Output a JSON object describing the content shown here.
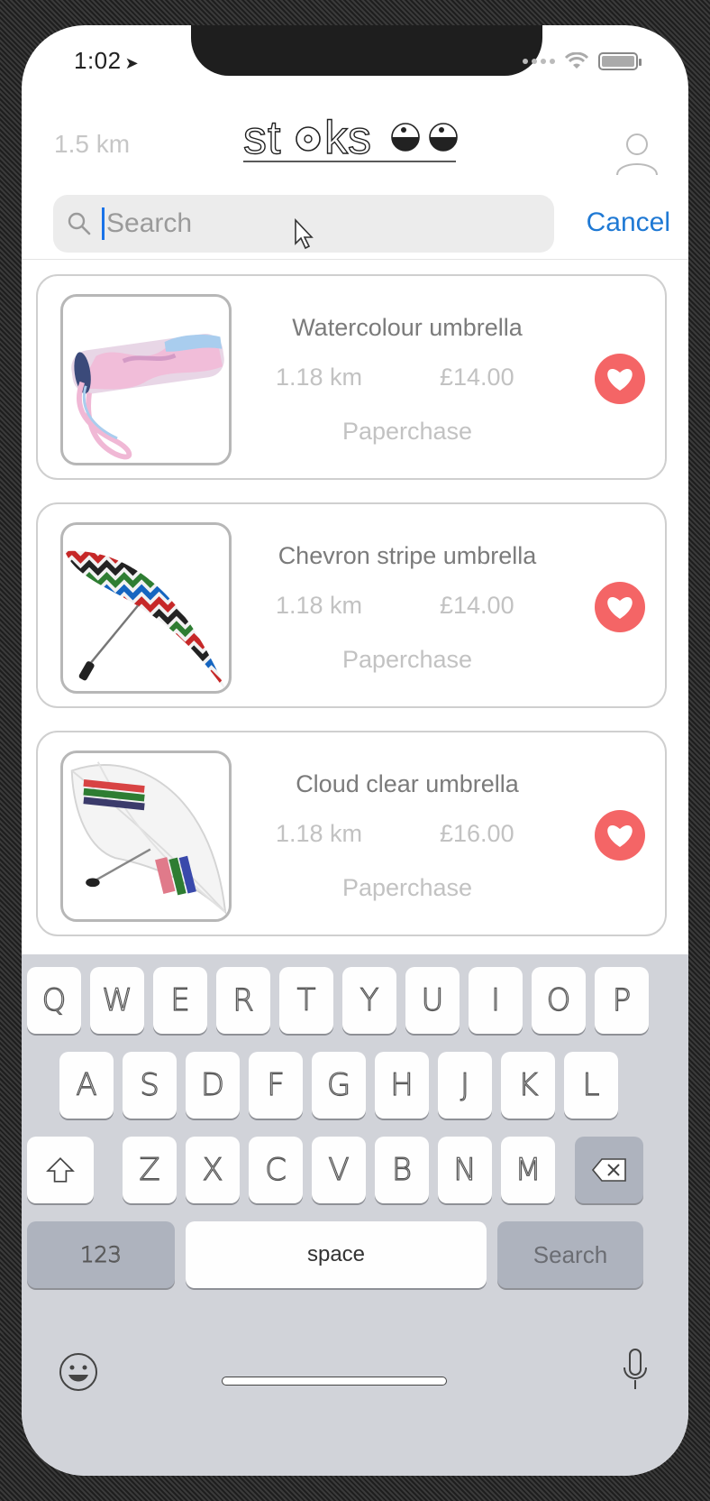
{
  "status_bar": {
    "time": "1:02"
  },
  "header": {
    "distance": "1.5 km",
    "logo_text": "stocksoo"
  },
  "search": {
    "placeholder": "Search",
    "cancel_label": "Cancel"
  },
  "products": [
    {
      "title": "Watercolour umbrella",
      "distance": "1.18 km",
      "price": "£14.00",
      "store": "Paperchase",
      "image": "watercolour-umbrella"
    },
    {
      "title": "Chevron stripe umbrella",
      "distance": "1.18 km",
      "price": "£14.00",
      "store": "Paperchase",
      "image": "chevron-umbrella"
    },
    {
      "title": "Cloud clear umbrella",
      "distance": "1.18 km",
      "price": "£16.00",
      "store": "Paperchase",
      "image": "clear-umbrella"
    }
  ],
  "keyboard": {
    "row1": [
      "Q",
      "W",
      "E",
      "R",
      "T",
      "Y",
      "U",
      "I",
      "O",
      "P"
    ],
    "row2": [
      "A",
      "S",
      "D",
      "F",
      "G",
      "H",
      "J",
      "K",
      "L"
    ],
    "row3": [
      "Z",
      "X",
      "C",
      "V",
      "B",
      "N",
      "M"
    ],
    "numbers_label": "123",
    "space_label": "space",
    "search_label": "Search"
  },
  "colors": {
    "accent": "#1f79d4",
    "heart": "#f46566",
    "keyboard_bg": "#d1d3d9"
  }
}
